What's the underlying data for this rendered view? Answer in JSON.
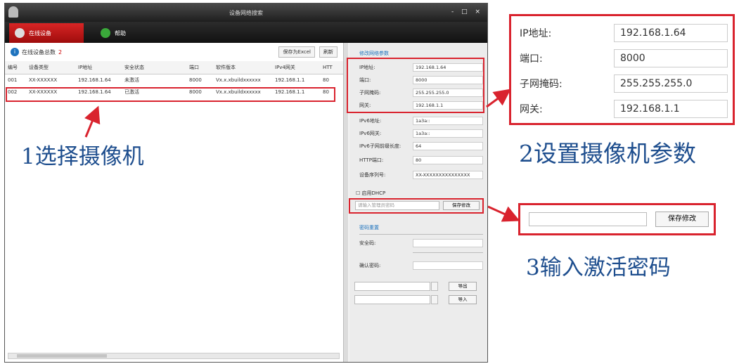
{
  "window": {
    "title": "设备网络搜索",
    "controls": "- □ ×"
  },
  "tabs": [
    {
      "label": "在线设备"
    },
    {
      "label": "帮助"
    }
  ],
  "list_header": {
    "label": "在线设备总数",
    "count": "2",
    "export_button": "保存为Excel",
    "refresh_button": "刷新"
  },
  "table": {
    "columns": [
      "编号",
      "设备类型",
      "IP地址",
      "安全状态",
      "端口",
      "软件版本",
      "IPv4网关",
      "HTT"
    ],
    "rows": [
      [
        "001",
        "XX-XXXXXX",
        "192.168.1.64",
        "未激活",
        "8000",
        "Vx.x.xbuildxxxxxx",
        "192.168.1.1",
        "80"
      ],
      [
        "002",
        "XX-XXXXXX",
        "192.168.1.64",
        "已激活",
        "8000",
        "Vx.x.xbuildxxxxxx",
        "192.168.1.1",
        "80"
      ]
    ]
  },
  "params": {
    "section_title": "修改网络参数",
    "fields": [
      {
        "label": "IP地址:",
        "value": "192.168.1.64"
      },
      {
        "label": "端口:",
        "value": "8000"
      },
      {
        "label": "子网掩码:",
        "value": "255.255.255.0"
      },
      {
        "label": "网关:",
        "value": "192.168.1.1"
      },
      {
        "label": "IPv6地址:",
        "value": "1a3a::"
      },
      {
        "label": "IPv6网关:",
        "value": "1a3a::"
      },
      {
        "label": "IPv6子网前缀长度:",
        "value": "64"
      },
      {
        "label": "HTTP端口:",
        "value": "80"
      },
      {
        "label": "设备序列号:",
        "value": "XX-XXXXXXXXXXXXXXX"
      }
    ],
    "dhcp_label": "启用DHCP",
    "password_placeholder": "请输入管理员密码",
    "save_button": "保存修改"
  },
  "reset": {
    "section_title": "密码重置",
    "security_code_label": "安全码:",
    "confirm_label": "确认密码:",
    "export_button": "导出",
    "import_button": "导入"
  },
  "zoom_params": [
    {
      "label": "IP地址:",
      "value": "192.168.1.64"
    },
    {
      "label": "端口:",
      "value": "8000"
    },
    {
      "label": "子网掩码:",
      "value": "255.255.255.0"
    },
    {
      "label": "网关:",
      "value": "192.168.1.1"
    }
  ],
  "zoom_password": {
    "save_button": "保存修改"
  },
  "annotations": {
    "step1": "1选择摄像机",
    "step2": "2设置摄像机参数",
    "step3": "3输入激活密码"
  },
  "colors": {
    "highlight": "#d9232e",
    "annotation": "#1e4e8e",
    "active_tab": "#c41a1a"
  }
}
